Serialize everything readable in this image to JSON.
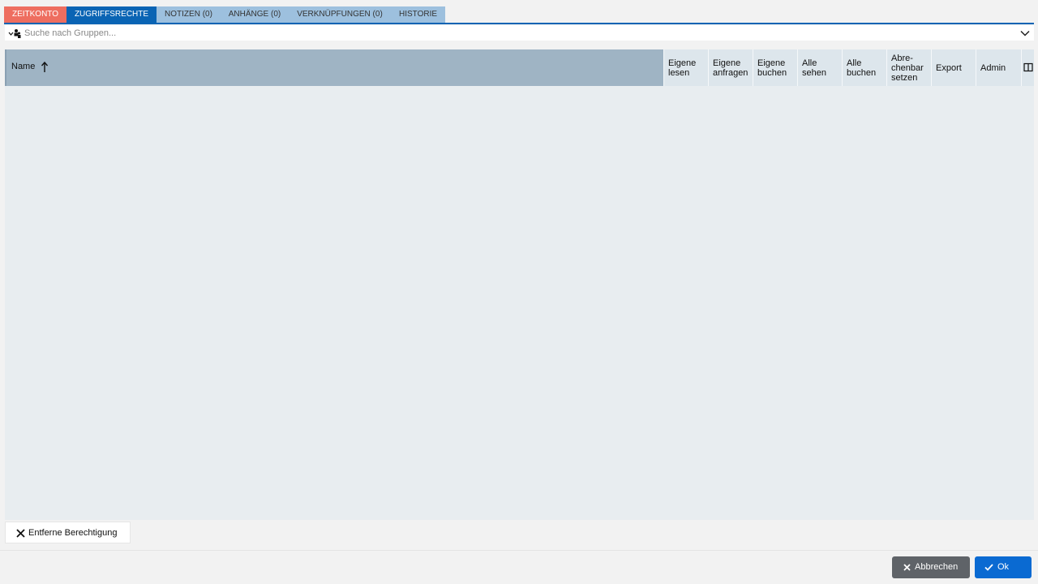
{
  "tabs": [
    {
      "label": "ZEITKONTO"
    },
    {
      "label": "ZUGRIFFSRECHTE"
    },
    {
      "label": "NOTIZEN (0)"
    },
    {
      "label": "ANHÄNGE (0)"
    },
    {
      "label": "VERKNÜPFUNGEN (0)"
    },
    {
      "label": "HISTORIE"
    }
  ],
  "active_tab": "ZUGRIFFSRECHTE",
  "search": {
    "placeholder": "Suche nach Gruppen...",
    "value": ""
  },
  "grid": {
    "columns": [
      {
        "label": "Name",
        "sort": "ascending"
      },
      {
        "label": "Eigene\nlesen"
      },
      {
        "label": "Eigene\nanfragen"
      },
      {
        "label": "Eigene\nbuchen"
      },
      {
        "label": "Alle\nsehen"
      },
      {
        "label": "Alle\nbuchen"
      },
      {
        "label": "Abre-\nchenbar\nsetzen"
      },
      {
        "label": "Export"
      },
      {
        "label": "Admin"
      }
    ],
    "rows": []
  },
  "toolbar": {
    "remove_label": "Entferne Berechtigung"
  },
  "footer": {
    "cancel_label": "Abbrechen",
    "ok_label": "Ok"
  },
  "colors": {
    "active_tab": "#0a64b4",
    "zeitkonto_tab": "#ee6e60",
    "tab": "#9dc0de",
    "ok_button": "#0a6ad2",
    "cancel_button": "#5f6368"
  }
}
